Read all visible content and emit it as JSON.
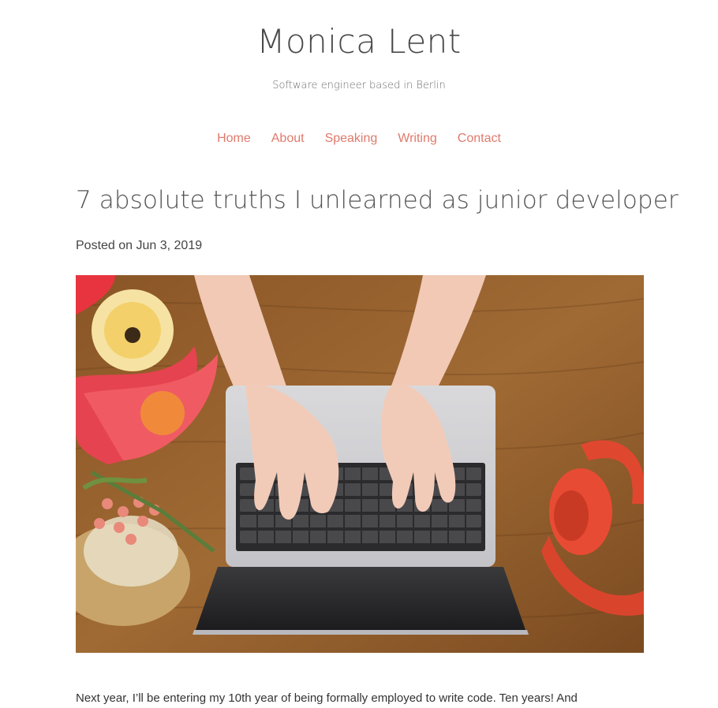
{
  "site": {
    "title": "Monica Lent",
    "tagline": "Software engineer based in Berlin"
  },
  "nav": {
    "items": [
      {
        "label": "Home"
      },
      {
        "label": "About"
      },
      {
        "label": "Speaking"
      },
      {
        "label": "Writing"
      },
      {
        "label": "Contact"
      }
    ]
  },
  "post": {
    "title": "7 absolute truths I unlearned as junior developer",
    "meta": "Posted on Jun 3, 2019",
    "first_paragraph": "Next year, I’ll be entering my 10th year of being formally employed to write code. Ten years! And"
  },
  "colors": {
    "link": "#e07a6c",
    "text": "#444444",
    "background": "#ffffff"
  }
}
